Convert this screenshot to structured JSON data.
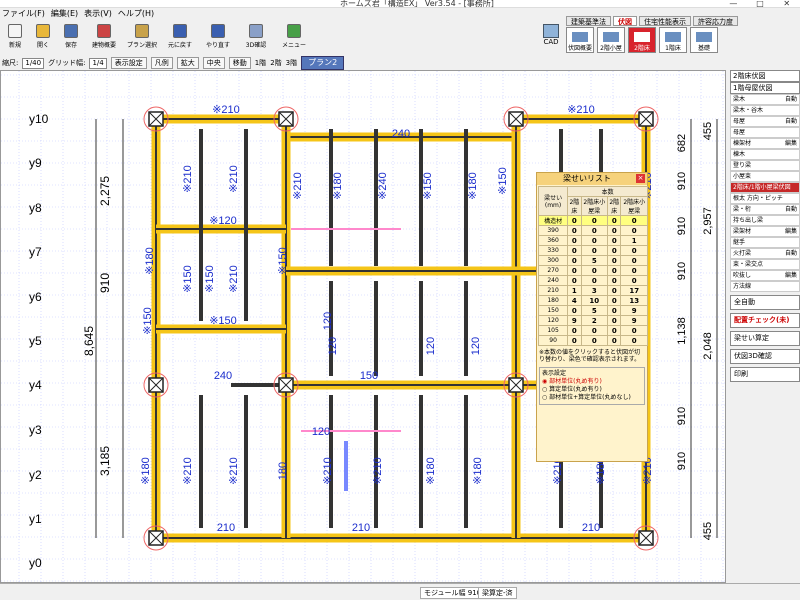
{
  "window": {
    "title": "ホームズ君「構造EX」 Ver3.54 - [事務所]",
    "controls": [
      "—",
      "□",
      "✕"
    ]
  },
  "menu": [
    "ファイル(F)",
    "編集(E)",
    "表示(V)",
    "ヘルプ(H)"
  ],
  "toolbar": [
    {
      "label": "新規",
      "icon": "new-file-icon",
      "color": "#f4f4f4"
    },
    {
      "label": "開く",
      "icon": "open-folder-icon",
      "color": "#e8b73a"
    },
    {
      "label": "保存",
      "icon": "save-icon",
      "color": "#4a6fb0"
    },
    {
      "label": "建物概要",
      "icon": "building-icon",
      "color": "#c44"
    },
    {
      "label": "プラン選択",
      "icon": "plan-select-icon",
      "color": "#c8a24a"
    },
    {
      "label": "元に戻す",
      "icon": "undo-icon",
      "color": "#3a5fb0"
    },
    {
      "label": "やり直す",
      "icon": "redo-icon",
      "color": "#3a5fb0"
    },
    {
      "label": "3D確認",
      "icon": "3d-view-icon",
      "color": "#8aa0c8"
    },
    {
      "label": "メニュー",
      "icon": "menu-icon",
      "color": "#48a048"
    }
  ],
  "cad": {
    "label": "CAD"
  },
  "mode_tabs": [
    {
      "label": "建築基準法",
      "active": false
    },
    {
      "label": "伏図",
      "active": true
    },
    {
      "label": "住宅性能表示",
      "active": false
    },
    {
      "label": "許容応力度",
      "active": false
    }
  ],
  "sub_tabs": [
    {
      "label": "伏図概要",
      "active": false
    },
    {
      "label": "2階小屋",
      "active": false
    },
    {
      "label": "2階床",
      "active": true
    },
    {
      "label": "1階床",
      "active": false
    },
    {
      "label": "基礎",
      "active": false
    }
  ],
  "toolbar2": {
    "scale_label": "縮尺:",
    "scale_value": "1/40",
    "grid_label": "グリッド幅:",
    "grid_value": "1/4",
    "buttons": [
      "表示設定",
      "凡例",
      "拡大",
      "中央",
      "移動"
    ],
    "floor_options": [
      "1階",
      "2階",
      "3階"
    ],
    "plan_label": "プラン2"
  },
  "drawing": {
    "y_axis_labels": [
      "y10",
      "y9",
      "y8",
      "y7",
      "y6",
      "y5",
      "y4",
      "y3",
      "y2",
      "y1",
      "y0"
    ],
    "left_dimensions": [
      "2,275",
      "910",
      "8,645",
      "3,185"
    ],
    "right_dimensions": [
      "455",
      "682",
      "910",
      "2,957",
      "910",
      "910",
      "2,048",
      "1,138",
      "910",
      "910",
      "455"
    ],
    "beam_labels": [
      "※210",
      "※210",
      "240",
      "※210",
      "※210",
      "※210",
      "※180",
      "※180",
      "※240",
      "※150",
      "※180",
      "※150",
      "※120",
      "※150",
      "※150",
      "※210",
      "※150",
      "※150",
      "120",
      "120",
      "120",
      "120",
      "240",
      "150",
      "※210",
      "※210",
      "180",
      "※210",
      "※210",
      "※180",
      "※180",
      "※180",
      "120",
      "210",
      "210",
      "210",
      "※210",
      "※180",
      "※210",
      "※210",
      "※210",
      "※210",
      "※150"
    ],
    "colors": {
      "grid": "#c0c8ff",
      "beam_main": "#f5c518",
      "beam_edge": "#333333",
      "label": "#1a2ccc",
      "pink": "#ff88cc",
      "blue": "#7788ff"
    }
  },
  "beam_list": {
    "title": "梁せいリスト",
    "header_count": "本数",
    "col_headers": [
      "梁せい(mm)",
      "2階床",
      "2階床小屋梁",
      "2階床",
      "2階床小屋梁"
    ],
    "rows": [
      {
        "size": "構造材",
        "vals": [
          "0",
          "0",
          "0",
          "0"
        ],
        "highlight": true
      },
      {
        "size": "390",
        "vals": [
          "0",
          "0",
          "0",
          "0"
        ]
      },
      {
        "size": "360",
        "vals": [
          "0",
          "0",
          "0",
          "1"
        ]
      },
      {
        "size": "330",
        "vals": [
          "0",
          "0",
          "0",
          "0"
        ]
      },
      {
        "size": "300",
        "vals": [
          "0",
          "5",
          "0",
          "0"
        ]
      },
      {
        "size": "270",
        "vals": [
          "0",
          "0",
          "0",
          "0"
        ]
      },
      {
        "size": "240",
        "vals": [
          "0",
          "0",
          "0",
          "0"
        ]
      },
      {
        "size": "210",
        "vals": [
          "1",
          "3",
          "0",
          "17"
        ]
      },
      {
        "size": "180",
        "vals": [
          "4",
          "10",
          "0",
          "13"
        ]
      },
      {
        "size": "150",
        "vals": [
          "0",
          "5",
          "0",
          "9"
        ]
      },
      {
        "size": "120",
        "vals": [
          "9",
          "2",
          "0",
          "9"
        ]
      },
      {
        "size": "105",
        "vals": [
          "0",
          "0",
          "0",
          "0"
        ]
      },
      {
        "size": "90",
        "vals": [
          "0",
          "0",
          "0",
          "0"
        ]
      }
    ],
    "note": "※本数の値をクリックすると伏図が切り替わり、梁色で確認表示されます。",
    "display_settings": "表示設定",
    "options": [
      "部材単位(丸め有り)",
      "算定単位(丸め有り)",
      "部材単位+算定単位(丸めなし)"
    ],
    "selected_option": 0
  },
  "right_panel": {
    "title": "2階床伏図",
    "subtitle": "1階母屋伏図",
    "items": [
      {
        "label": "梁木",
        "right": "自動"
      },
      {
        "label": "梁木・谷木",
        "right": ""
      },
      {
        "label": "母屋",
        "right": "自動"
      },
      {
        "label": "母屋",
        "right": ""
      },
      {
        "label": "棟架材",
        "right": "編集"
      },
      {
        "label": "棟木",
        "right": ""
      },
      {
        "label": "登り梁",
        "right": ""
      },
      {
        "label": "小屋束",
        "right": ""
      },
      {
        "label": "2階床/1階小屋梁伏図",
        "right": "",
        "red": true
      },
      {
        "label": "根太 方向・ピッチ",
        "right": ""
      },
      {
        "label": "梁・桁",
        "right": "自動"
      },
      {
        "label": "持ち出し梁",
        "right": ""
      },
      {
        "label": "梁架材",
        "right": "編集"
      },
      {
        "label": "継手",
        "right": ""
      },
      {
        "label": "火打梁",
        "right": "自動"
      },
      {
        "label": "束・梁交点",
        "right": ""
      },
      {
        "label": "吹抜し",
        "right": "編集"
      },
      {
        "label": "方法線",
        "right": ""
      }
    ],
    "buttons": [
      "全自動",
      "配置チェック(未)",
      "梁せい算定",
      "伏図3D確認",
      "印刷"
    ]
  },
  "status": {
    "module": "モジュール幅 910mm",
    "mode": "梁算定-済"
  }
}
